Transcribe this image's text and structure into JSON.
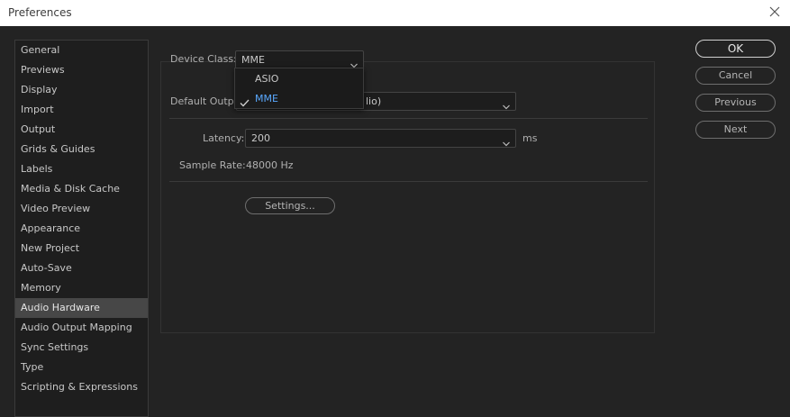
{
  "window": {
    "title": "Preferences"
  },
  "sidebar": {
    "selected": "Audio Hardware",
    "items": [
      {
        "label": "General"
      },
      {
        "label": "Previews"
      },
      {
        "label": "Display"
      },
      {
        "label": "Import"
      },
      {
        "label": "Output"
      },
      {
        "label": "Grids & Guides"
      },
      {
        "label": "Labels"
      },
      {
        "label": "Media & Disk Cache"
      },
      {
        "label": "Video Preview"
      },
      {
        "label": "Appearance"
      },
      {
        "label": "New Project"
      },
      {
        "label": "Auto-Save"
      },
      {
        "label": "Memory"
      },
      {
        "label": "Audio Hardware"
      },
      {
        "label": "Audio Output Mapping"
      },
      {
        "label": "Sync Settings"
      },
      {
        "label": "Type"
      },
      {
        "label": "Scripting & Expressions"
      }
    ]
  },
  "audio": {
    "device_class_label": "Device Class:",
    "device_class_value": "MME",
    "default_output_label": "Default Output",
    "default_output_visible_tail": "lio)",
    "latency_label": "Latency:",
    "latency_value": "200",
    "latency_unit": "ms",
    "sample_rate_label": "Sample Rate:",
    "sample_rate_value": "48000 Hz",
    "settings_button": "Settings..."
  },
  "dropdown": {
    "options": [
      {
        "label": "ASIO",
        "checked": false
      },
      {
        "label": "MME",
        "checked": true
      }
    ],
    "active_color": "#5aa9ff"
  },
  "buttons": {
    "ok": "OK",
    "cancel": "Cancel",
    "previous": "Previous",
    "next": "Next"
  },
  "icons": {
    "close": "close-icon",
    "chevron": "chevron-down-icon",
    "check": "check-icon"
  }
}
